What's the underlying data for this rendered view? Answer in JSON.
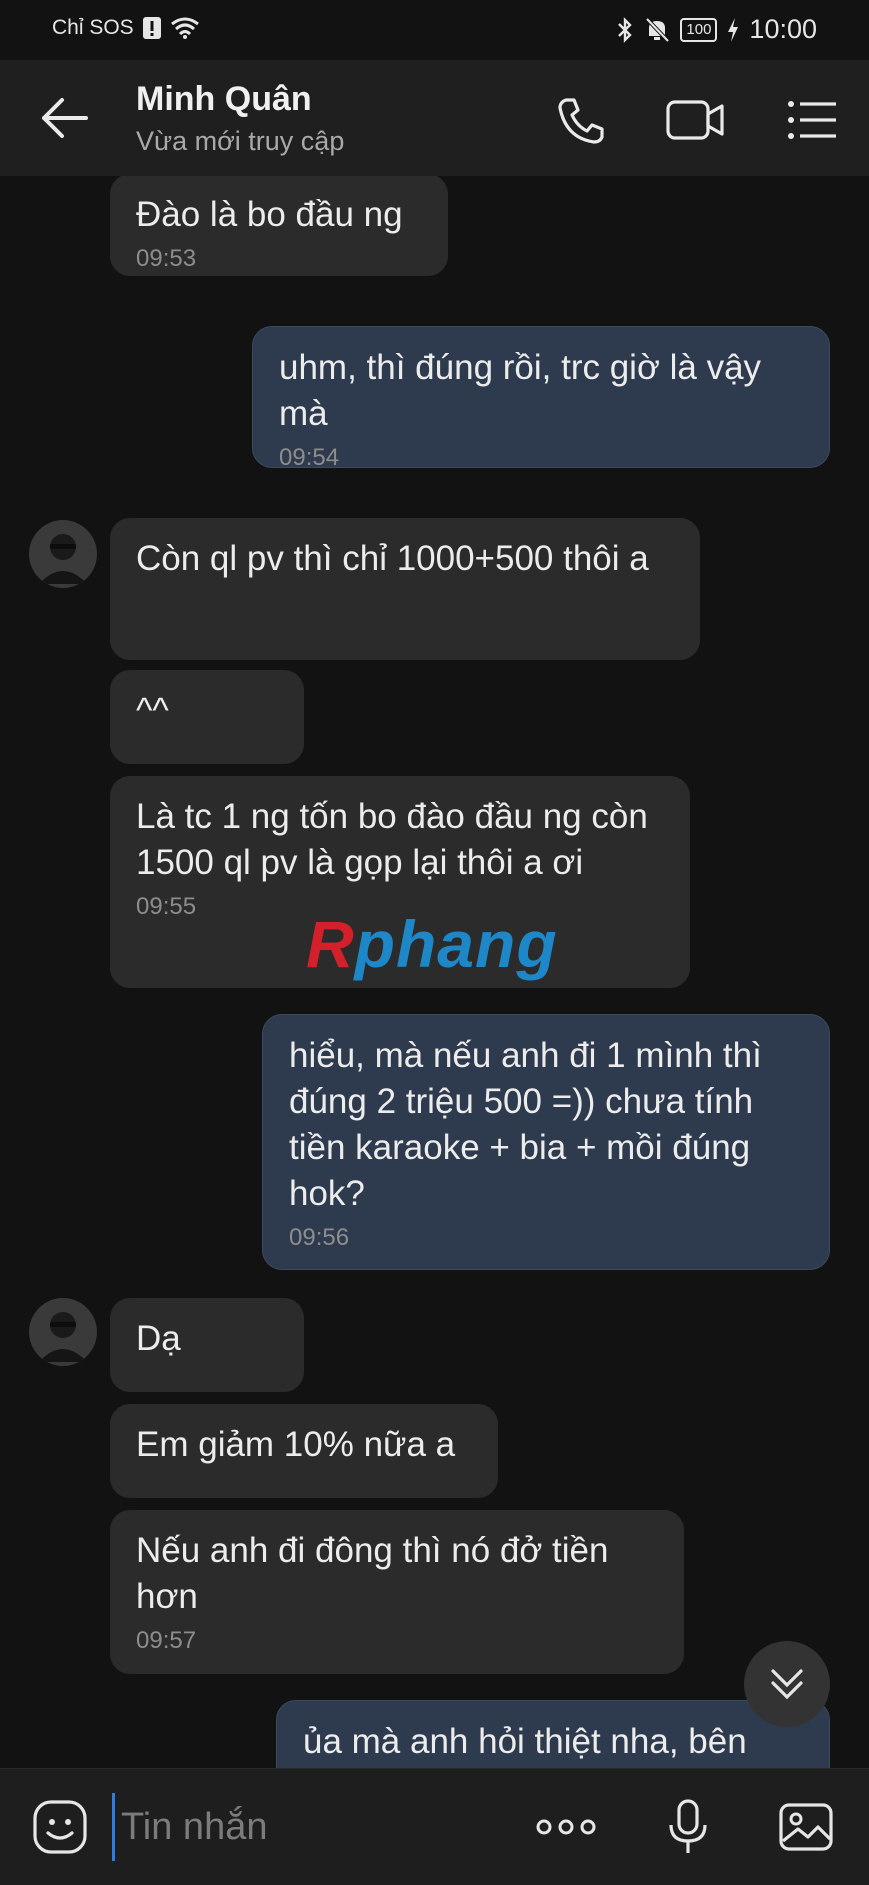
{
  "status": {
    "carrier": "Chỉ SOS",
    "battery": "100",
    "time": "10:00"
  },
  "header": {
    "name": "Minh Quân",
    "status": "Vừa mới truy cập"
  },
  "messages": [
    {
      "dir": "in",
      "text": "Đào là bo đầu ng",
      "time": "09:53"
    },
    {
      "dir": "out",
      "text": "uhm, thì đúng rồi, trc giờ là vậy mà",
      "time": "09:54"
    },
    {
      "dir": "in",
      "text": "Còn ql pv thì chỉ 1000+500 thôi a",
      "time": ""
    },
    {
      "dir": "in",
      "text": "^^",
      "time": ""
    },
    {
      "dir": "in",
      "text": "Là tc 1 ng tốn bo đào đầu ng còn 1500 ql pv là gọp lại thôi a ơi",
      "time": "09:55"
    },
    {
      "dir": "out",
      "text": "hiểu, mà nếu anh đi 1 mình thì đúng 2 triệu 500 =)) chưa tính tiền karaoke + bia + mồi đúng hok?",
      "time": "09:56"
    },
    {
      "dir": "in",
      "text": "Dạ",
      "time": ""
    },
    {
      "dir": "in",
      "text": "Em giảm 10% nữa a",
      "time": ""
    },
    {
      "dir": "in",
      "text": "Nếu anh đi đông thì nó đở tiền hơn",
      "time": "09:57"
    },
    {
      "dir": "out",
      "text": "ủa mà anh hỏi thiệt nha, bên",
      "time": ""
    }
  ],
  "watermark": {
    "r": "R",
    "rest": "phang"
  },
  "input": {
    "placeholder": "Tin nhắn"
  },
  "icons": {
    "back": "back-arrow-icon",
    "call": "phone-icon",
    "video": "video-camera-icon",
    "menu": "list-menu-icon",
    "sticker": "sticker-icon",
    "more": "more-dots-icon",
    "mic": "microphone-icon",
    "image": "image-icon",
    "scroll_down": "chevron-double-down-icon"
  }
}
